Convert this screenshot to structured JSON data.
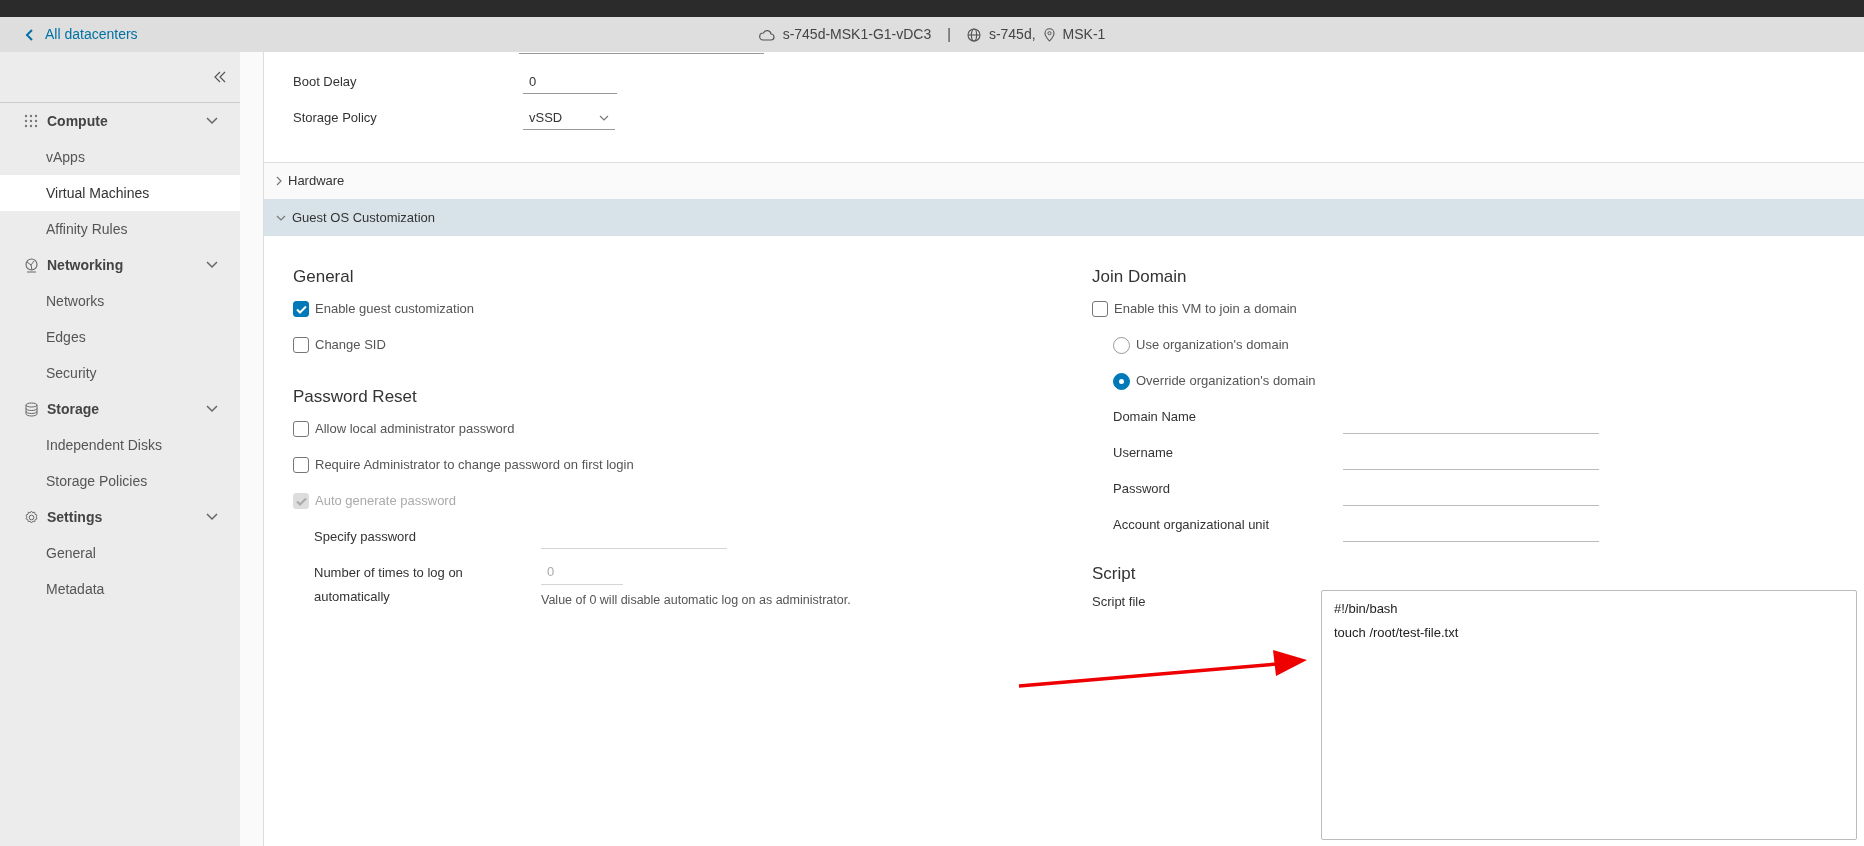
{
  "header": {
    "back_link": "All datacenters",
    "title": "s-745d-MSK1-G1-vDC3",
    "separator": "|",
    "org": "s-745d,",
    "location": "MSK-1"
  },
  "sidebar": {
    "groups": [
      {
        "label": "Compute",
        "expanded": true,
        "items": [
          {
            "label": "vApps",
            "selected": false
          },
          {
            "label": "Virtual Machines",
            "selected": true
          },
          {
            "label": "Affinity Rules",
            "selected": false
          }
        ]
      },
      {
        "label": "Networking",
        "expanded": true,
        "items": [
          {
            "label": "Networks",
            "selected": false
          },
          {
            "label": "Edges",
            "selected": false
          },
          {
            "label": "Security",
            "selected": false
          }
        ]
      },
      {
        "label": "Storage",
        "expanded": true,
        "items": [
          {
            "label": "Independent Disks",
            "selected": false
          },
          {
            "label": "Storage Policies",
            "selected": false
          }
        ]
      },
      {
        "label": "Settings",
        "expanded": true,
        "items": [
          {
            "label": "General",
            "selected": false
          },
          {
            "label": "Metadata",
            "selected": false
          }
        ]
      }
    ]
  },
  "settings": {
    "fields": [
      {
        "label": "Boot Delay",
        "kind": "text",
        "value": "0"
      },
      {
        "label": "Storage Policy",
        "kind": "select",
        "value": "vSSD"
      }
    ]
  },
  "sections": [
    {
      "title": "Hardware",
      "expanded": false
    },
    {
      "title": "Guest OS Customization",
      "expanded": true
    }
  ],
  "general": {
    "title": "General",
    "options": [
      {
        "label": "Enable guest customization",
        "checked": true,
        "disabled": false
      },
      {
        "label": "Change SID",
        "checked": false,
        "disabled": false
      }
    ]
  },
  "password_reset": {
    "title": "Password Reset",
    "options": [
      {
        "label": "Allow local administrator password",
        "checked": false,
        "disabled": false
      },
      {
        "label": "Require Administrator to change password on first login",
        "checked": false,
        "disabled": false
      },
      {
        "label": "Auto generate password",
        "checked": true,
        "disabled": true
      }
    ],
    "fields": [
      {
        "label": "Specify password",
        "kind": "text",
        "disabled": true
      },
      {
        "label": "Number of times to log on automatically",
        "kind": "number",
        "placeholder": "0",
        "hint": "Value of 0 will disable automatic log on as administrator.",
        "disabled": true
      }
    ]
  },
  "join_domain": {
    "title": "Join Domain",
    "checkbox": {
      "label": "Enable this VM to join a domain",
      "checked": false
    },
    "radios": [
      {
        "label": "Use organization's domain",
        "selected": false
      },
      {
        "label": "Override organization's domain",
        "selected": true
      }
    ],
    "fields": [
      {
        "label": "Domain Name"
      },
      {
        "label": "Username"
      },
      {
        "label": "Password"
      },
      {
        "label": "Account organizational unit"
      }
    ]
  },
  "script": {
    "title": "Script",
    "label": "Script file",
    "lines": [
      "#!/bin/bash",
      "touch /root/test-file.txt"
    ]
  }
}
